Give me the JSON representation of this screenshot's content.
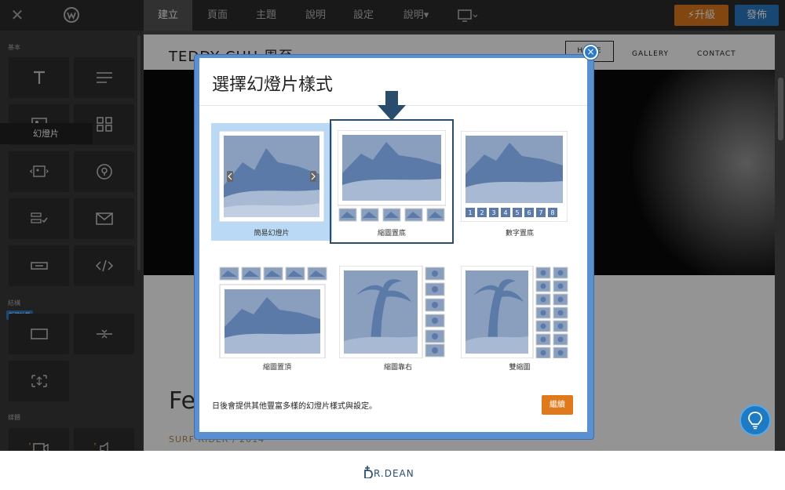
{
  "topbar": {
    "close_icon": "close-icon",
    "logo_icon": "weebly-logo-icon",
    "tabs": [
      {
        "label": "建立",
        "active": true
      },
      {
        "label": "頁面"
      },
      {
        "label": "主題"
      },
      {
        "label": "說明"
      },
      {
        "label": "設定"
      },
      {
        "label": "說明▾"
      }
    ],
    "device_icon": "monitor-icon",
    "upgrade_label": "⚡升級",
    "publish_label": "發佈",
    "upgrade_color": "#e0791c",
    "publish_color": "#2b7bc9"
  },
  "sidebar": {
    "sections": {
      "basic": "基本",
      "structure": "結構",
      "media": "媒體"
    },
    "tooltip": "幻燈片",
    "feature_badge": "新增功能",
    "tiles": [
      {
        "icon": "text-icon"
      },
      {
        "icon": "paragraph-icon"
      },
      {
        "icon": "image-icon"
      },
      {
        "icon": "gallery-grid-icon"
      },
      {
        "icon": "slideshow-icon"
      },
      {
        "icon": "map-pin-icon"
      },
      {
        "icon": "form-icon"
      },
      {
        "icon": "email-icon"
      },
      {
        "icon": "button-icon"
      },
      {
        "icon": "embed-code-icon"
      },
      {
        "icon": "section-icon"
      },
      {
        "icon": "divider-icon"
      },
      {
        "icon": "spacer-icon"
      },
      {
        "icon": "video-icon"
      },
      {
        "icon": "audio-icon"
      }
    ]
  },
  "site": {
    "title": "TEDDY CHU 周至",
    "nav": [
      "HOME",
      "GALLERY",
      "CONTACT"
    ],
    "post_title": "Fe",
    "post_sub": "SURF RIDER / 2014"
  },
  "modal": {
    "title": "選擇幻燈片樣式",
    "close_label": "×",
    "options": [
      {
        "label": "簡易幻燈片",
        "selected": true
      },
      {
        "label": "縮圖置底",
        "highlighted": true
      },
      {
        "label": "數字置底"
      },
      {
        "label": "縮圖置頂"
      },
      {
        "label": "縮圖靠右"
      },
      {
        "label": "雙縮圖"
      }
    ],
    "numbers": [
      "1",
      "2",
      "3",
      "4",
      "5",
      "6",
      "7",
      "8"
    ],
    "footer_text": "日後會提供其他豐富多樣的幻燈片樣式與設定。",
    "continue_label": "繼續",
    "accent": "#2b7bc9",
    "continue_color": "#e0791c"
  },
  "watermark": {
    "text": "R.DEAN"
  }
}
